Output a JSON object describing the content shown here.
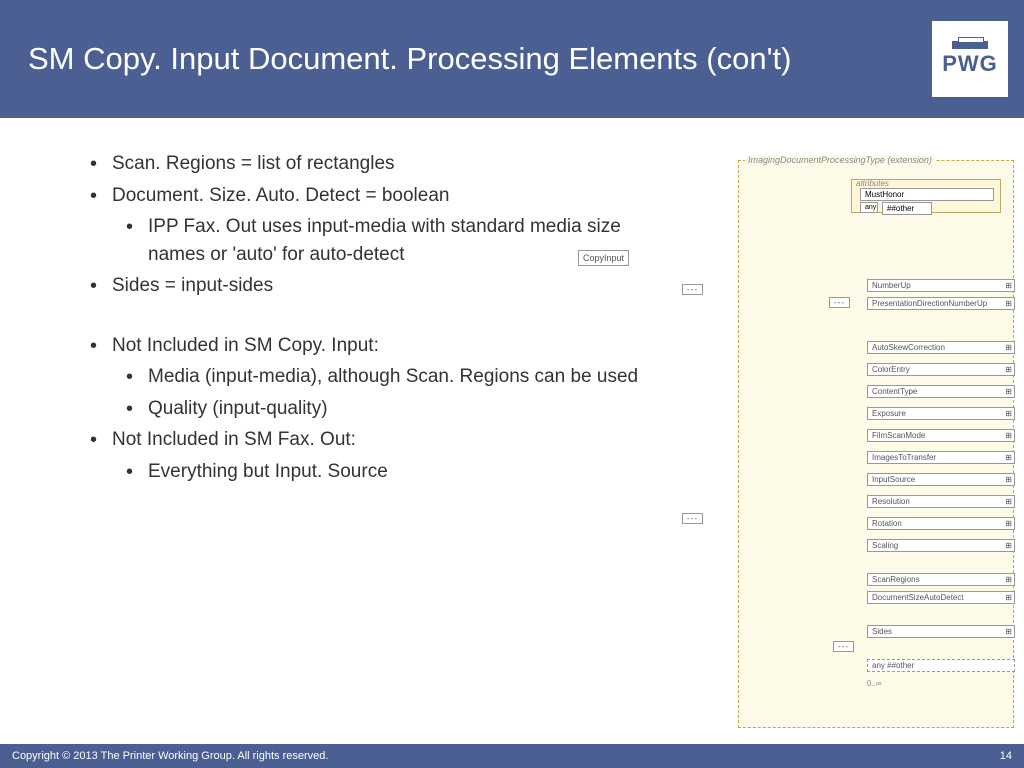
{
  "header": {
    "title": "SM Copy. Input Document. Processing Elements (con't)",
    "logo_text": "PWG"
  },
  "bullets": {
    "b1": "Scan. Regions = list of rectangles",
    "b2": "Document. Size. Auto. Detect = boolean",
    "b2a": "IPP Fax. Out uses input-media with standard media size names or 'auto' for auto-detect",
    "b3": "Sides = input-sides",
    "b4": "Not Included in SM Copy. Input:",
    "b4a": "Media (input-media), although Scan. Regions can be used",
    "b4b": "Quality (input-quality)",
    "b5": "Not Included in SM Fax. Out:",
    "b5a": "Everything but Input. Source"
  },
  "diagram": {
    "main_title": "ImagingDocumentProcessingType (extension)",
    "attributes_label": "attributes",
    "must_honor": "MustHonor",
    "any_label": "any",
    "any_other": "##other",
    "copy_input": "CopyInput",
    "dots": "---",
    "elements": {
      "e1": "NumberUp",
      "e2": "PresentationDirectionNumberUp",
      "e3": "AutoSkewCorrection",
      "e4": "ColorEntry",
      "e5": "ContentType",
      "e6": "Exposure",
      "e7": "FilmScanMode",
      "e8": "ImagesToTransfer",
      "e9": "InputSource",
      "e10": "Resolution",
      "e11": "Rotation",
      "e12": "Scaling",
      "e13": "ScanRegions",
      "e14": "DocumentSizeAutoDetect",
      "e15": "Sides",
      "e16": "any ##other"
    },
    "cardinality": "0..∞"
  },
  "footer": {
    "copyright": "Copyright © 2013 The Printer Working Group. All rights reserved.",
    "page": "14"
  }
}
